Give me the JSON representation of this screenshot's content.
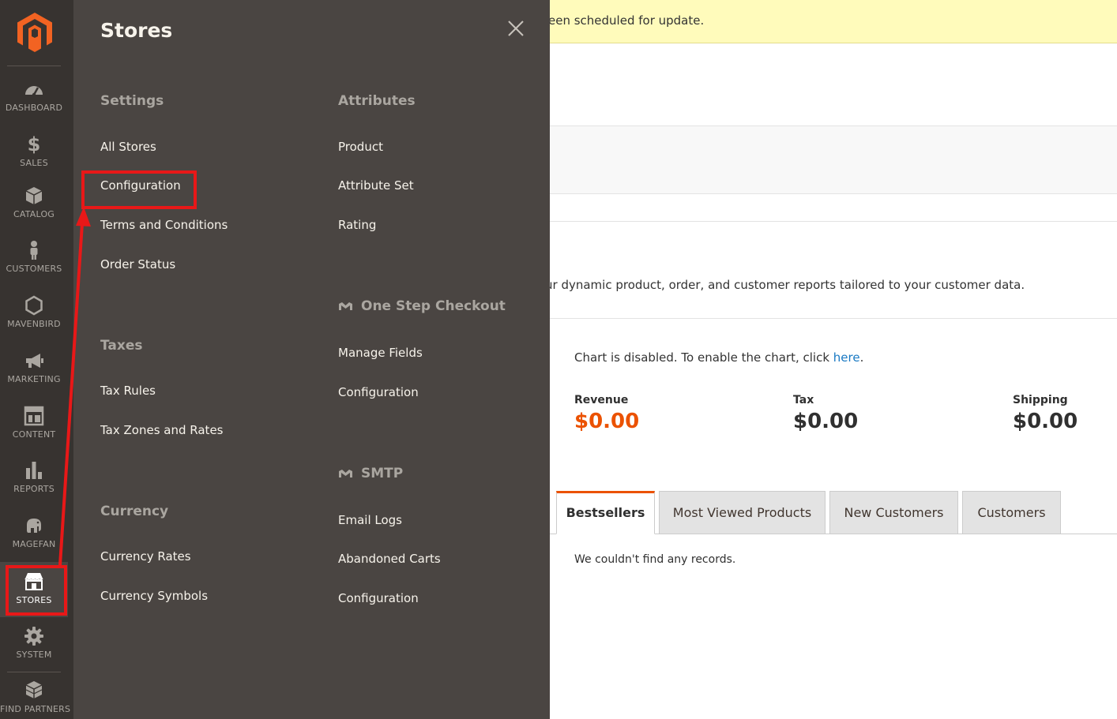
{
  "sidebar": {
    "items": [
      {
        "label": "DASHBOARD",
        "icon": "dashboard-icon"
      },
      {
        "label": "SALES",
        "icon": "dollar-icon"
      },
      {
        "label": "CATALOG",
        "icon": "cube-icon"
      },
      {
        "label": "CUSTOMERS",
        "icon": "person-icon"
      },
      {
        "label": "MAVENBIRD",
        "icon": "hexagon-icon"
      },
      {
        "label": "MARKETING",
        "icon": "megaphone-icon"
      },
      {
        "label": "CONTENT",
        "icon": "layout-icon"
      },
      {
        "label": "REPORTS",
        "icon": "bar-chart-icon"
      },
      {
        "label": "MAGEFAN",
        "icon": "elephant-icon"
      },
      {
        "label": "STORES",
        "icon": "storefront-icon"
      },
      {
        "label": "SYSTEM",
        "icon": "gear-icon"
      },
      {
        "label": "FIND PARTNERS",
        "icon": "boxes-icon"
      }
    ],
    "active": "STORES"
  },
  "flyout": {
    "title": "Stores",
    "settings": {
      "title": "Settings",
      "links": [
        "All Stores",
        "Configuration",
        "Terms and Conditions",
        "Order Status"
      ]
    },
    "taxes": {
      "title": "Taxes",
      "links": [
        "Tax Rules",
        "Tax Zones and Rates"
      ]
    },
    "currency": {
      "title": "Currency",
      "links": [
        "Currency Rates",
        "Currency Symbols"
      ]
    },
    "attributes": {
      "title": "Attributes",
      "links": [
        "Product",
        "Attribute Set",
        "Rating"
      ]
    },
    "one_step_checkout": {
      "title": "One Step Checkout",
      "links": [
        "Manage Fields",
        "Configuration"
      ]
    },
    "smtp": {
      "title": "SMTP",
      "links": [
        "Email Logs",
        "Abandoned Carts",
        "Configuration"
      ]
    }
  },
  "main": {
    "notice": "een scheduled for update.",
    "advanced_reporting": "ur dynamic product, order, and customer reports tailored to your customer data.",
    "chart_disabled": "Chart is disabled. To enable the chart, click ",
    "chart_link": "here",
    "chart_period": ".",
    "totals": [
      {
        "label": "Revenue",
        "value": "$0.00"
      },
      {
        "label": "Tax",
        "value": "$0.00"
      },
      {
        "label": "Shipping",
        "value": "$0.00"
      }
    ],
    "tabs": [
      "Bestsellers",
      "Most Viewed Products",
      "New Customers",
      "Customers"
    ],
    "active_tab": "Bestsellers",
    "empty_message": "We couldn't find any records."
  },
  "colors": {
    "sidebar_bg": "#373330",
    "flyout_bg": "#4a4542",
    "accent": "#eb5202",
    "notice_bg": "#fffbbb",
    "annotation": "#e81818",
    "link": "#1979c3"
  }
}
